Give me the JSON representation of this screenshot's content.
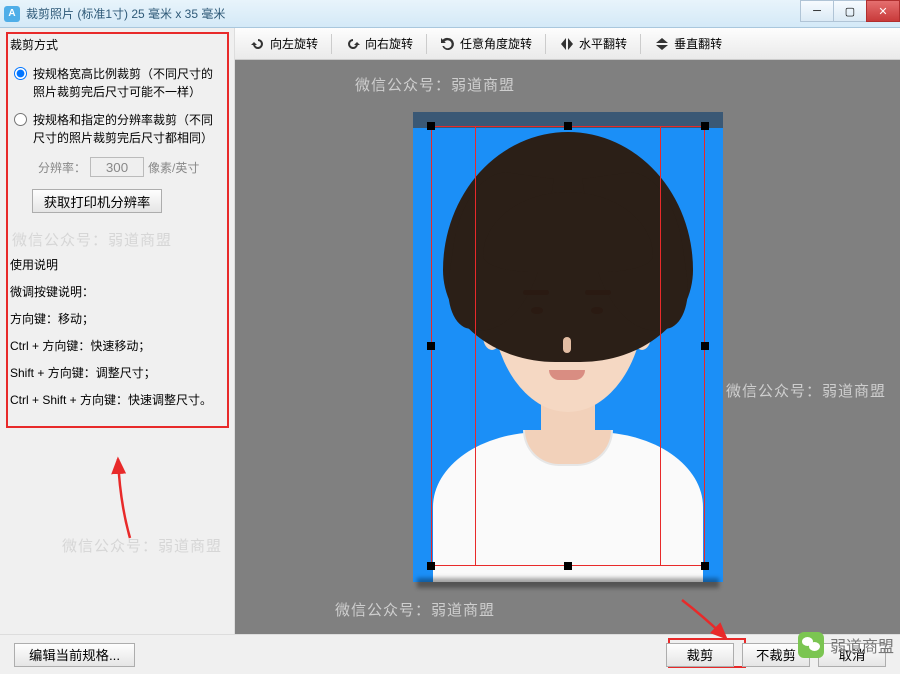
{
  "window": {
    "title": "裁剪照片 (标准1寸) 25 毫米 x 35 毫米"
  },
  "sidebar": {
    "section_title": "裁剪方式",
    "radio1": "按规格宽高比例裁剪（不同尺寸的照片裁剪完后尺寸可能不一样）",
    "radio2": "按规格和指定的分辨率裁剪（不同尺寸的照片裁剪完后尺寸都相同）",
    "dpi_label": "分辨率：",
    "dpi_value": "300",
    "dpi_unit": "像素/英寸",
    "get_dpi_btn": "获取打印机分辨率",
    "watermark": "微信公众号：弱道商盟",
    "instr_title": "使用说明",
    "instr_sub": "微调按键说明：",
    "instr1": "方向键：移动；",
    "instr2": "Ctrl + 方向键：快速移动；",
    "instr3": "Shift + 方向键：调整尺寸；",
    "instr4": "Ctrl + Shift + 方向键：快速调整尺寸。"
  },
  "toolbar": {
    "rotate_left": "向左旋转",
    "rotate_right": "向右旋转",
    "rotate_any": "任意角度旋转",
    "flip_h": "水平翻转",
    "flip_v": "垂直翻转"
  },
  "stage": {
    "watermark": "微信公众号：弱道商盟"
  },
  "footer": {
    "edit_spec": "编辑当前规格...",
    "crop": "裁剪",
    "no_crop": "不裁剪",
    "cancel": "取消"
  },
  "overlay": {
    "brand": "弱道商盟"
  }
}
